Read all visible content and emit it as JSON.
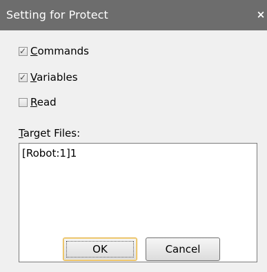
{
  "window": {
    "title": "Setting for Protect",
    "close_glyph": "×"
  },
  "options": [
    {
      "pre": "",
      "accel": "C",
      "rest": "ommands",
      "checked": true
    },
    {
      "pre": "",
      "accel": "V",
      "rest": "ariables",
      "checked": true
    },
    {
      "pre": "",
      "accel": "R",
      "rest": "ead",
      "checked": false
    }
  ],
  "target_files": {
    "label_accel": "T",
    "label_rest": "arget Files:",
    "items": [
      "[Robot:1]1"
    ]
  },
  "buttons": {
    "ok_label": "OK",
    "cancel_label": "Cancel"
  },
  "icons": {
    "close": "close-icon",
    "check": "checkmark-icon"
  }
}
